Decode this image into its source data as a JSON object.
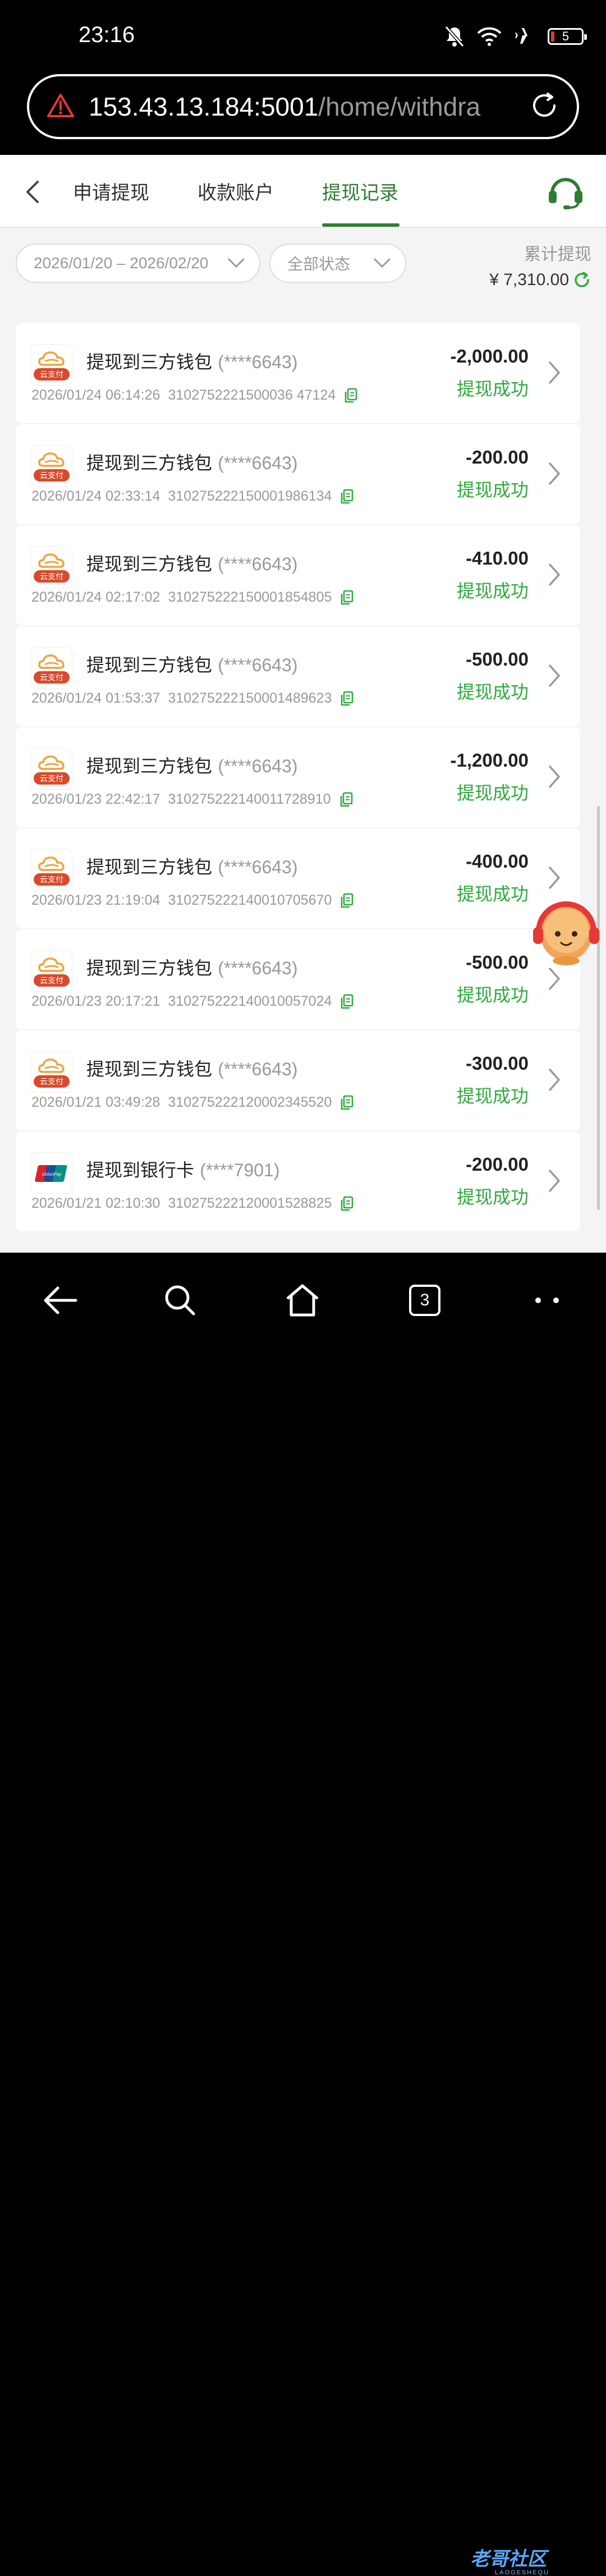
{
  "status_bar": {
    "time": "23:16",
    "battery": "5"
  },
  "browser": {
    "url_host": "153.43.13.184:5001",
    "url_path": "/home/withdra"
  },
  "tabs": [
    {
      "label": "申请提现",
      "active": false
    },
    {
      "label": "收款账户",
      "active": false
    },
    {
      "label": "提现记录",
      "active": true
    }
  ],
  "filters": {
    "date_range": "2026/01/20 – 2026/02/20",
    "status": "全部状态"
  },
  "summary": {
    "label": "累计提现",
    "amount": "¥ 7,310.00"
  },
  "records": [
    {
      "logo": "cloudpay",
      "title": "提现到三方钱包",
      "account": "(****6643)",
      "time": "2026/01/24 06:14:26",
      "order": "3102752221500036 47124",
      "amount": "-2,000.00",
      "status": "提现成功"
    },
    {
      "logo": "cloudpay",
      "title": "提现到三方钱包",
      "account": "(****6643)",
      "time": "2026/01/24 02:33:14",
      "order": "310275222150001986134",
      "amount": "-200.00",
      "status": "提现成功"
    },
    {
      "logo": "cloudpay",
      "title": "提现到三方钱包",
      "account": "(****6643)",
      "time": "2026/01/24 02:17:02",
      "order": "310275222150001854805",
      "amount": "-410.00",
      "status": "提现成功"
    },
    {
      "logo": "cloudpay",
      "title": "提现到三方钱包",
      "account": "(****6643)",
      "time": "2026/01/24 01:53:37",
      "order": "310275222150001489623",
      "amount": "-500.00",
      "status": "提现成功"
    },
    {
      "logo": "cloudpay",
      "title": "提现到三方钱包",
      "account": "(****6643)",
      "time": "2026/01/23 22:42:17",
      "order": "310275222140011728910",
      "amount": "-1,200.00",
      "status": "提现成功"
    },
    {
      "logo": "cloudpay",
      "title": "提现到三方钱包",
      "account": "(****6643)",
      "time": "2026/01/23 21:19:04",
      "order": "310275222140010705670",
      "amount": "-400.00",
      "status": "提现成功"
    },
    {
      "logo": "cloudpay",
      "title": "提现到三方钱包",
      "account": "(****6643)",
      "time": "2026/01/23 20:17:21",
      "order": "310275222140010057024",
      "amount": "-500.00",
      "status": "提现成功"
    },
    {
      "logo": "cloudpay",
      "title": "提现到三方钱包",
      "account": "(****6643)",
      "time": "2026/01/21 03:49:28",
      "order": "310275222120002345520",
      "amount": "-300.00",
      "status": "提现成功"
    },
    {
      "logo": "unionpay",
      "title": "提现到银行卡",
      "account": "(****7901)",
      "time": "2026/01/21 02:10:30",
      "order": "310275222120001528825",
      "amount": "-200.00",
      "status": "提现成功"
    }
  ],
  "logos": {
    "cloudpay_text": "云支付",
    "unionpay_text": "UnionPay 银联"
  },
  "nav": {
    "tab_count": "3"
  },
  "watermark": {
    "text": "老哥社区",
    "sub": "LAOGESHEQU"
  },
  "colors": {
    "accent": "#2e7d32",
    "success": "#2eab3d",
    "cloudpay_red": "#d84a2b",
    "cloudpay_orange": "#f2a33a"
  }
}
